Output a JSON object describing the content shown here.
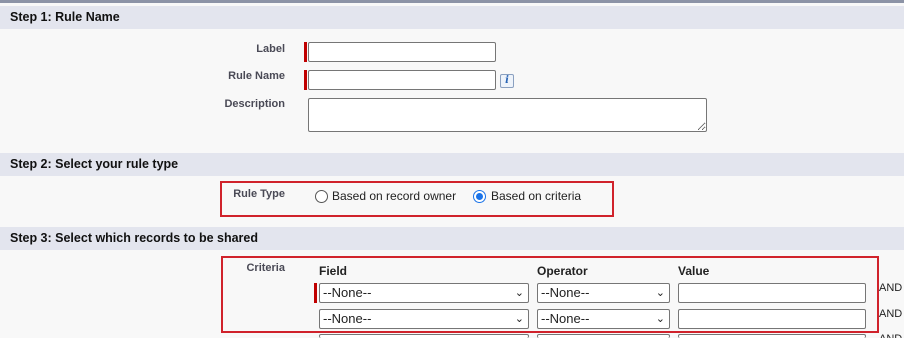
{
  "step1": {
    "title": "Step 1: Rule Name",
    "label_label": "Label",
    "label_value": "",
    "rule_name_label": "Rule Name",
    "rule_name_value": "",
    "info_glyph": "i",
    "description_label": "Description",
    "description_value": ""
  },
  "step2": {
    "title": "Step 2: Select your rule type",
    "rule_type_label": "Rule Type",
    "option_owner": "Based on record owner",
    "option_criteria": "Based on criteria",
    "selected": "Based on criteria"
  },
  "step3": {
    "title": "Step 3: Select which records to be shared",
    "criteria_label": "Criteria",
    "col_field": "Field",
    "col_operator": "Operator",
    "col_value": "Value",
    "rows": [
      {
        "field": "--None--",
        "operator": "--None--",
        "value": "",
        "conj": "AND"
      },
      {
        "field": "--None--",
        "operator": "--None--",
        "value": "",
        "conj": "AND"
      },
      {
        "conj": "AND"
      }
    ]
  },
  "colors": {
    "highlight_border": "#d0222b",
    "required_marker": "#c00000",
    "section_band": "#e3e5ee",
    "radio_selected": "#1a73e8"
  }
}
